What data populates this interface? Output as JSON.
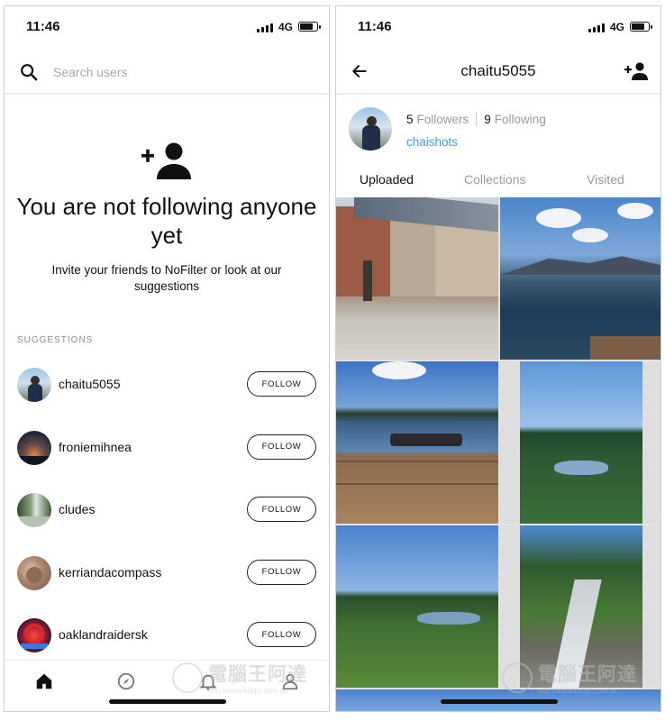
{
  "left_screen": {
    "status": {
      "time": "11:46",
      "network": "4G"
    },
    "search": {
      "placeholder": "Search users"
    },
    "empty_state": {
      "title": "You are not following anyone yet",
      "subtitle": "Invite your friends to NoFilter or look at our suggestions"
    },
    "suggestions_label": "SUGGESTIONS",
    "suggestions": [
      {
        "username": "chaitu5055",
        "button": "FOLLOW"
      },
      {
        "username": "froniemihnea",
        "button": "FOLLOW"
      },
      {
        "username": "cludes",
        "button": "FOLLOW"
      },
      {
        "username": "kerriandacompass",
        "button": "FOLLOW"
      },
      {
        "username": "oaklandraidersk",
        "button": "FOLLOW"
      }
    ],
    "bottom_nav": [
      "home-icon",
      "compass-icon",
      "bell-icon",
      "profile-icon"
    ],
    "watermark": {
      "text": "電腦王阿達",
      "url": "http://www.kocpc.com.tw"
    }
  },
  "right_screen": {
    "status": {
      "time": "11:46",
      "network": "4G"
    },
    "title": "chaitu5055",
    "followers_count": "5",
    "followers_label": "Followers",
    "following_count": "9",
    "following_label": "Following",
    "handle_link": "chaishots",
    "tabs": [
      "Uploaded",
      "Collections",
      "Visited"
    ],
    "active_tab": "Uploaded",
    "photos": [
      "quebec-street-photo",
      "lake-mountain-photo",
      "dock-bollard-photo",
      "forest-lake-photo",
      "green-hills-photo",
      "mountain-stream-photo"
    ],
    "watermark": {
      "text": "電腦王阿達",
      "url": "http://www.kocpc.com.tw"
    }
  },
  "colors": {
    "accent_link": "#3aa0d8",
    "divider": "#ececec",
    "muted_text": "#9a9a9a"
  }
}
